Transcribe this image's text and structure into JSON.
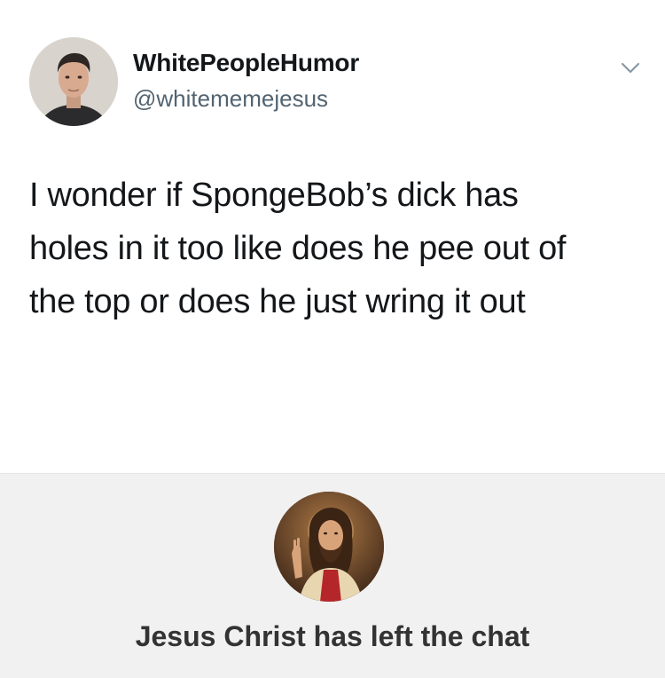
{
  "tweet": {
    "display_name": "WhitePeopleHumor",
    "handle": "@whitememejesus",
    "text_lines": [
      "I wonder if SpongeBob’s dick has",
      "holes in it too like does he pee out of",
      "the top or does he just wring it out"
    ],
    "menu_icon": "chevron-down-icon"
  },
  "chat": {
    "left_message": "Jesus Christ has left the chat",
    "avatar_icon": "jesus-portrait"
  },
  "colors": {
    "text_primary": "#14171a",
    "text_secondary": "#536471",
    "panel_background": "#f1f1f1",
    "chevron": "#8899a6"
  }
}
